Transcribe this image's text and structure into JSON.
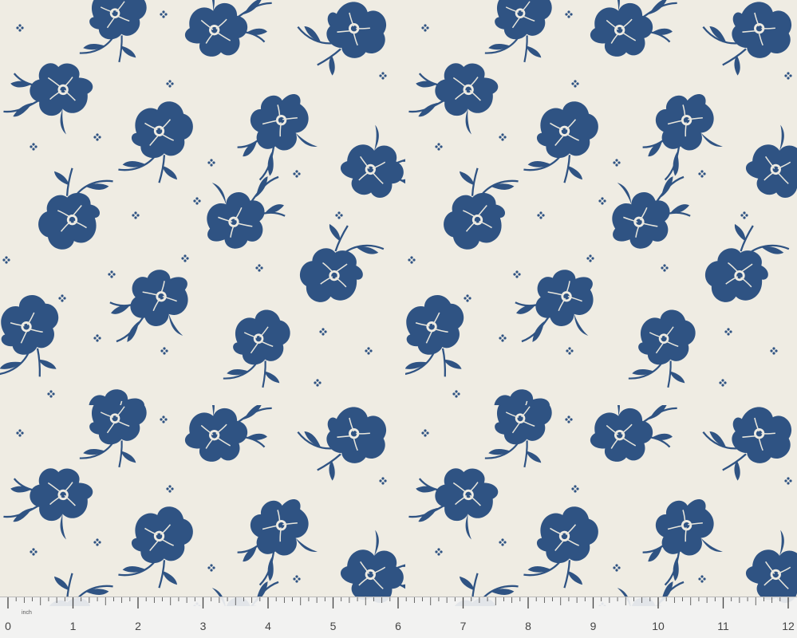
{
  "image": {
    "subject": "Fabric swatch with scattered navy blue flowers on cream background, measured against a ruler",
    "colors": {
      "background": "#efece3",
      "flower": "#2f5383",
      "flower_highlight": "#e8e6dc",
      "ruler": "#f2f2f2",
      "ruler_marks": "#444444"
    }
  },
  "ruler": {
    "unit_label": "inch",
    "numbers": [
      "0",
      "1",
      "2",
      "3",
      "4",
      "5",
      "6",
      "7",
      "8",
      "9",
      "10",
      "11",
      "12"
    ]
  }
}
